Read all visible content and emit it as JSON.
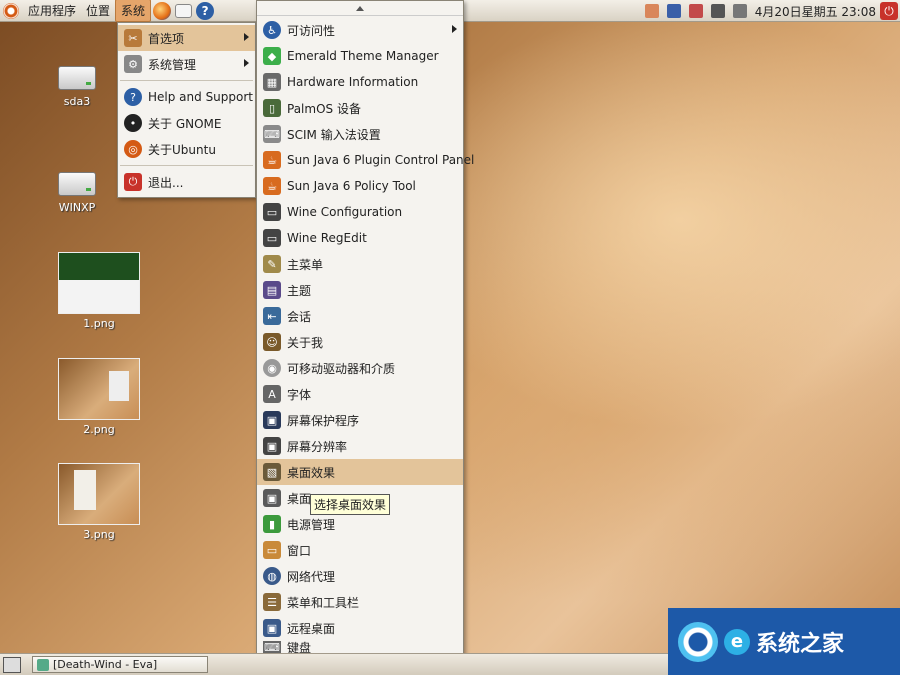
{
  "top_panel": {
    "menus": [
      "应用程序",
      "位置",
      "系统"
    ],
    "clock": "4月20日星期五 23:08"
  },
  "desktop": {
    "icons": [
      {
        "label": "sda3"
      },
      {
        "label": "WINXP"
      },
      {
        "label": "1.png"
      },
      {
        "label": "2.png"
      },
      {
        "label": "3.png"
      }
    ]
  },
  "system_menu": {
    "items": [
      "首选项",
      "系统管理",
      "Help and Support",
      "关于 GNOME",
      "关于Ubuntu",
      "退出..."
    ]
  },
  "prefs_menu": {
    "items": [
      "可访问性",
      "Emerald Theme Manager",
      "Hardware Information",
      "PalmOS 设备",
      "SCIM 输入法设置",
      "Sun Java 6 Plugin Control Panel",
      "Sun Java 6 Policy Tool",
      "Wine Configuration",
      "Wine RegEdit",
      "主菜单",
      "主题",
      "会话",
      "关于我",
      "可移动驱动器和介质",
      "字体",
      "屏幕保护程序",
      "屏幕分辨率",
      "桌面效果",
      "桌面",
      "电源管理",
      "窗口",
      "网络代理",
      "菜单和工具栏",
      "远程桌面",
      "键盘"
    ],
    "tooltip": "选择桌面效果"
  },
  "taskbar": {
    "task": "[Death-Wind - Eva]"
  },
  "watermark": {
    "text": "系统之家"
  },
  "colors": {
    "panel": "#e5dfd3",
    "highlight": "#e3c49a",
    "menu_bg": "#f5f3ef",
    "watermark_bg": "#1d59a8"
  }
}
